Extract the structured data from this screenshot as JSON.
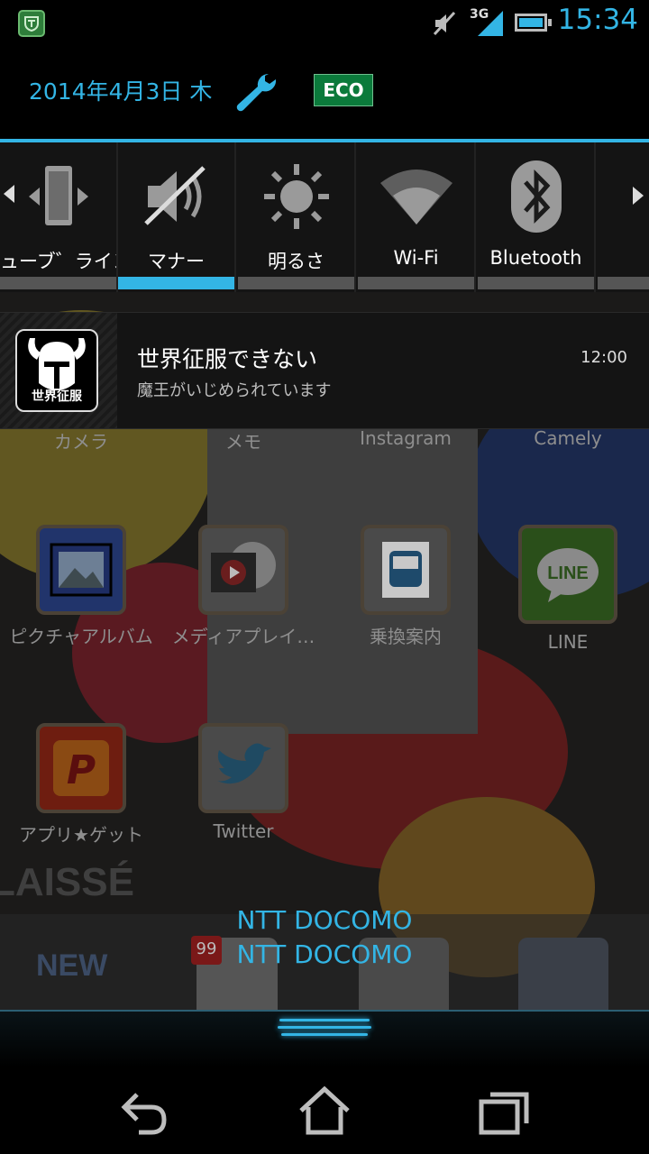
{
  "status_bar": {
    "app_icon": "shield-app-icon",
    "network_type": "3G",
    "time": "15:34",
    "accent": "#33b5e5"
  },
  "shade_header": {
    "date": "2014年4月3日 木",
    "eco_label": "ECO"
  },
  "quick_toggles": [
    {
      "label": "ューブ゛ライント゛",
      "icon": "auto-rotate-icon",
      "active": false
    },
    {
      "label": "マナー",
      "icon": "muted-speaker-icon",
      "active": true
    },
    {
      "label": "明るさ",
      "icon": "brightness-icon",
      "active": false
    },
    {
      "label": "Wi-Fi",
      "icon": "wifi-icon",
      "active": false
    },
    {
      "label": "Bluetooth",
      "icon": "bluetooth-icon",
      "active": false
    }
  ],
  "notification": {
    "icon_caption": "世界征服",
    "title": "世界征服できない",
    "text": "魔王がいじめられています",
    "time": "12:00"
  },
  "home_apps": {
    "row0": [
      "カメラ",
      "メモ",
      "Instagram",
      "Camely"
    ],
    "row1": [
      "ピクチャアルバム",
      "メディアプレイ…",
      "乗換案内",
      "LINE"
    ],
    "row2": [
      "アプリ★ゲット",
      "Twitter"
    ],
    "wallpaper_text": "LAISSÉ",
    "line_icon_text": "LINE",
    "badge_count": "99",
    "new_text": "NEW"
  },
  "carrier": {
    "line1": "NTT DOCOMO",
    "line2": "NTT DOCOMO"
  },
  "nav": [
    "back-icon",
    "home-icon",
    "recent-apps-icon"
  ]
}
